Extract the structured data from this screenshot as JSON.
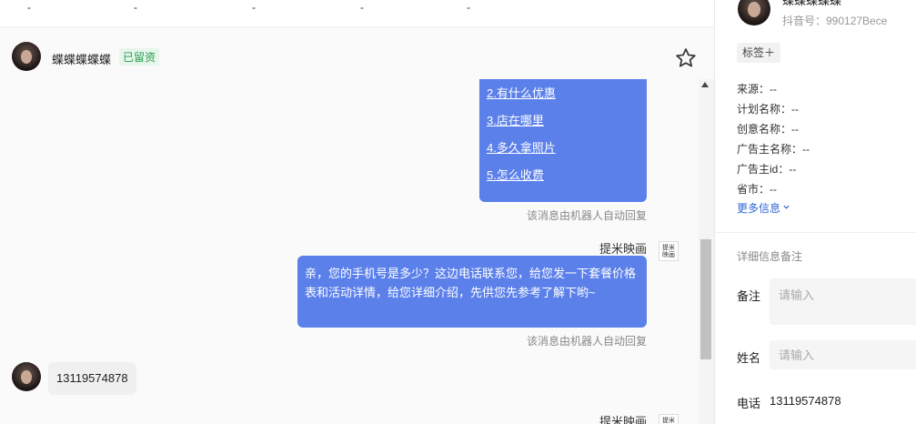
{
  "top_strip": {
    "dashes": [
      "-",
      "-",
      "-",
      "-",
      "-"
    ]
  },
  "chat_header": {
    "name": "蝶蝶蝶蝶蝶",
    "badge": "已留资"
  },
  "messages": {
    "menu_items": [
      "2.有什么优惠",
      "3.店在哪里",
      "4.多久拿照片",
      "5.怎么收费"
    ],
    "auto_reply_note": "该消息由机器人自动回复",
    "sender_name": "提米映画",
    "logo_text": "提米映画",
    "bot_message": "亲，您的手机号是多少？这边电话联系您，给您发一下套餐价格表和活动详情，给您详细介绍，先供您先参考了解下哟~",
    "customer_phone": "13119574878"
  },
  "sidebar": {
    "user_name": "蝶蝶蝶蝶蝶",
    "douyin_id": "抖音号：990127Bece",
    "tag_label": "标签＋",
    "info_rows": [
      "来源：--",
      "计划名称：--",
      "创意名称：--",
      "广告主名称：--",
      "广告主id：--",
      "省市：--"
    ],
    "more_info": "更多信息",
    "section_title": "详细信息备注",
    "note_label": "备注",
    "note_placeholder": "请输入",
    "name_label": "姓名",
    "name_placeholder": "请输入",
    "phone_label": "电话",
    "phone_value": "13119574878"
  },
  "colors": {
    "accent_blue": "#5b80ea",
    "badge_green": "#2b9a52",
    "link_blue": "#2e66d6"
  }
}
